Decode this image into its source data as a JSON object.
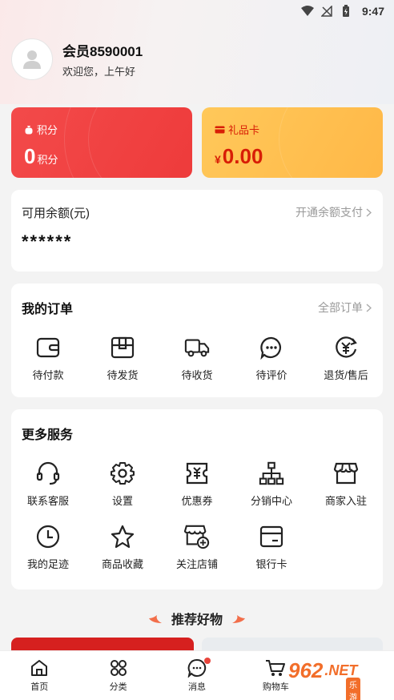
{
  "status_bar": {
    "time": "9:47"
  },
  "profile": {
    "name": "会员8590001",
    "greeting": "欢迎您，上午好"
  },
  "points_card": {
    "label": "积分",
    "value": "0",
    "unit": "积分"
  },
  "gift_card": {
    "label": "礼品卡",
    "currency": "¥",
    "value": "0.00"
  },
  "balance": {
    "title": "可用余额(元)",
    "link": "开通余额支付",
    "masked_value": "******"
  },
  "orders": {
    "title": "我的订单",
    "link": "全部订单",
    "items": [
      {
        "label": "待付款",
        "icon": "wallet-icon"
      },
      {
        "label": "待发货",
        "icon": "box-icon"
      },
      {
        "label": "待收货",
        "icon": "truck-icon"
      },
      {
        "label": "待评价",
        "icon": "chat-icon"
      },
      {
        "label": "退货/售后",
        "icon": "refund-icon"
      }
    ]
  },
  "services": {
    "title": "更多服务",
    "items": [
      {
        "label": "联系客服",
        "icon": "headset-icon"
      },
      {
        "label": "设置",
        "icon": "gear-icon"
      },
      {
        "label": "优惠券",
        "icon": "coupon-icon"
      },
      {
        "label": "分销中心",
        "icon": "org-chart-icon"
      },
      {
        "label": "商家入驻",
        "icon": "store-icon"
      },
      {
        "label": "我的足迹",
        "icon": "clock-icon"
      },
      {
        "label": "商品收藏",
        "icon": "star-icon"
      },
      {
        "label": "关注店铺",
        "icon": "store-add-icon"
      },
      {
        "label": "银行卡",
        "icon": "card-icon"
      }
    ]
  },
  "recommend": {
    "title": "推荐好物"
  },
  "tabbar": {
    "items": [
      {
        "label": "首页",
        "icon": "home-icon"
      },
      {
        "label": "分类",
        "icon": "grid-icon"
      },
      {
        "label": "消息",
        "icon": "message-icon"
      },
      {
        "label": "购物车",
        "icon": "cart-icon"
      },
      {
        "label": "",
        "icon": ""
      }
    ]
  },
  "watermark": {
    "number": "962",
    "domain": ".NET",
    "sub": "乐游网"
  },
  "colors": {
    "accent_red": "#ee3b3b",
    "gift_yellow": "#ffb847",
    "gift_text": "#d81e06",
    "badge_red": "#e8453c"
  }
}
